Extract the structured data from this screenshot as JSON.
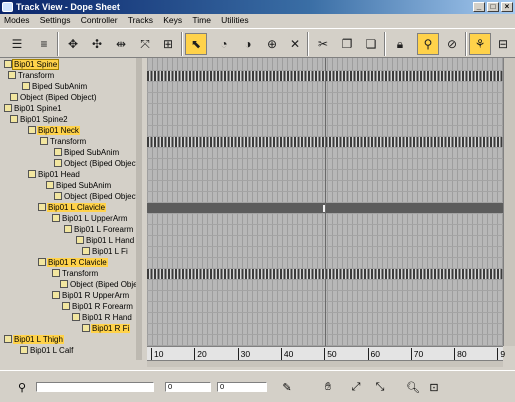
{
  "window": {
    "title": "Track View - Dope Sheet",
    "minimize": "_",
    "maximize": "□",
    "close": "×"
  },
  "menu": [
    "Modes",
    "Settings",
    "Controller",
    "Tracks",
    "Keys",
    "Time",
    "Utilities"
  ],
  "tree": [
    {
      "label": "Bip01 Spine",
      "style": "sel"
    },
    {
      "label": "Transform",
      "style": ""
    },
    {
      "label": "Biped SubAnim",
      "style": ""
    },
    {
      "label": "Object (Biped Object)",
      "style": ""
    },
    {
      "label": "Bip01 Spine1",
      "style": ""
    },
    {
      "label": "Bip01 Spine2",
      "style": ""
    },
    {
      "label": "Bip01 Neck",
      "style": "hl"
    },
    {
      "label": "Transform",
      "style": ""
    },
    {
      "label": "Biped SubAnim",
      "style": ""
    },
    {
      "label": "Object (Biped Object)",
      "style": ""
    },
    {
      "label": "Bip01 Head",
      "style": ""
    },
    {
      "label": "Biped SubAnim",
      "style": ""
    },
    {
      "label": "Object (Biped Object",
      "style": ""
    },
    {
      "label": "Bip01 L Clavicle",
      "style": "hl"
    },
    {
      "label": "Bip01 L UpperArm",
      "style": ""
    },
    {
      "label": "Bip01 L Forearm",
      "style": ""
    },
    {
      "label": "Bip01 L Hand",
      "style": ""
    },
    {
      "label": "Bip01 L Fi",
      "style": ""
    },
    {
      "label": "Bip01 R Clavicle",
      "style": "hl"
    },
    {
      "label": "Transform",
      "style": ""
    },
    {
      "label": "Object (Biped Object",
      "style": ""
    },
    {
      "label": "Bip01 R UpperArm",
      "style": ""
    },
    {
      "label": "Bip01 R Forearm",
      "style": ""
    },
    {
      "label": "Bip01 R Hand",
      "style": ""
    },
    {
      "label": "Bip01 R Fi",
      "style": "hl"
    },
    {
      "label": "Bip01 L Thigh",
      "style": "hl"
    },
    {
      "label": "Bip01 L Calf",
      "style": ""
    }
  ],
  "sheet_rows": [
    "empty",
    "keys",
    "empty",
    "empty",
    "empty",
    "empty",
    "empty",
    "keys",
    "empty",
    "empty",
    "empty",
    "empty",
    "empty",
    "dark",
    "empty",
    "empty",
    "empty",
    "empty",
    "empty",
    "keys",
    "empty",
    "empty",
    "empty",
    "empty",
    "empty",
    "empty",
    "dark"
  ],
  "ruler": [
    "10",
    "20",
    "30",
    "40",
    "50",
    "60",
    "70",
    "80",
    "9"
  ],
  "status": {
    "field1": "",
    "field2": "0",
    "field3": "0"
  },
  "toolbar_icons": [
    "filters-icon",
    "edit-keys-icon",
    "move-keys-icon",
    "move-keys-horizontal-icon",
    "slide-keys-icon",
    "scale-keys-icon",
    "add-keys-icon",
    "select-time-icon",
    "scale-time-icon",
    "insert-time-icon",
    "reverse-time-icon",
    "delete-time-icon",
    "cut-time-icon",
    "copy-time-icon",
    "paste-time-icon",
    "lock-selection-icon",
    "snap-frames-icon",
    "show-keyable-icon",
    "modify-subtree-icon",
    "modify-child-keys-icon"
  ]
}
